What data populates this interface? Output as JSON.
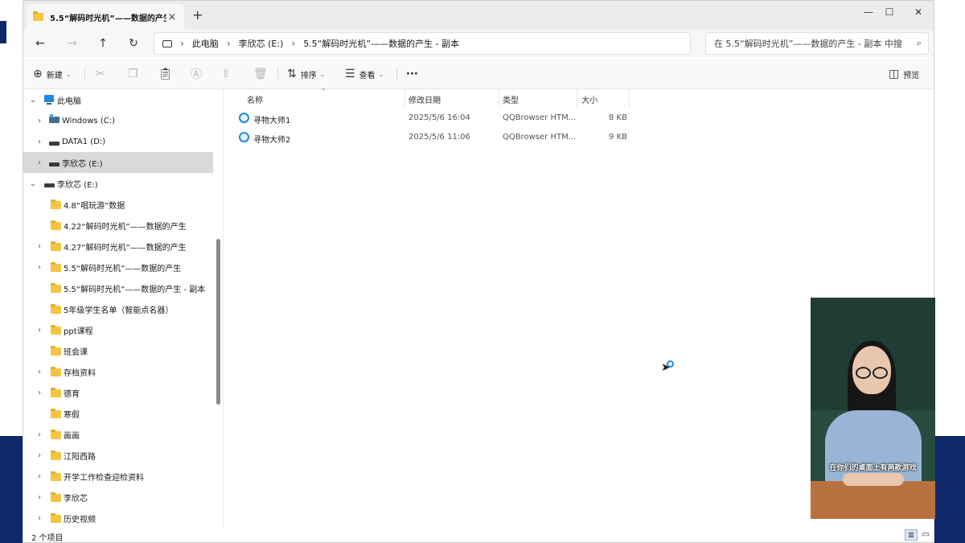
{
  "window": {
    "tab_title": "5.5“解码时光机”——数据的产生",
    "tab_close": "×",
    "new_tab": "+",
    "minimize": "—",
    "maximize": "☐",
    "close": "✕"
  },
  "nav": {
    "back": "←",
    "forward": "→",
    "up": "↑",
    "refresh": "↻",
    "breadcrumb": [
      "此电脑",
      "李欣芯 (E:)",
      "5.5“解码时光机”——数据的产生 - 副本"
    ],
    "search_placeholder": "在 5.5“解码时光机”——数据的产生 - 副本 中搜"
  },
  "toolbar": {
    "new_label": "新建",
    "sort_label": "排序",
    "view_label": "查看",
    "more_label": "···",
    "preview_label": "预览"
  },
  "sidebar": {
    "items": [
      {
        "label": "此电脑",
        "icon": "pc"
      },
      {
        "label": "Windows (C:)",
        "icon": "windows-drive"
      },
      {
        "label": "DATA1 (D:)",
        "icon": "drive"
      },
      {
        "label": "李欣芯 (E:)",
        "icon": "drive"
      },
      {
        "label": "李欣芯 (E:)",
        "icon": "drive"
      },
      {
        "label": "4.8“唱玩游”数据",
        "icon": "folder"
      },
      {
        "label": "4.22“解码时光机”——数据的产生",
        "icon": "folder"
      },
      {
        "label": "4.27“解码时光机”——数据的产生",
        "icon": "folder"
      },
      {
        "label": "5.5“解码时光机”——数据的产生",
        "icon": "folder"
      },
      {
        "label": "5.5“解码时光机”——数据的产生 - 副本",
        "icon": "folder"
      },
      {
        "label": "5年级学生名单（智能点名器）",
        "icon": "folder"
      },
      {
        "label": "ppt课程",
        "icon": "folder"
      },
      {
        "label": "班会课",
        "icon": "folder"
      },
      {
        "label": "存档资料",
        "icon": "folder"
      },
      {
        "label": "德育",
        "icon": "folder"
      },
      {
        "label": "寒假",
        "icon": "folder"
      },
      {
        "label": "画画",
        "icon": "folder"
      },
      {
        "label": "江阳西路",
        "icon": "folder"
      },
      {
        "label": "开学工作检查迎检资料",
        "icon": "folder"
      },
      {
        "label": "李欣芯",
        "icon": "folder"
      },
      {
        "label": "历史视频",
        "icon": "folder"
      }
    ]
  },
  "file_list": {
    "columns": [
      "名称",
      "修改日期",
      "类型",
      "大小"
    ],
    "rows": [
      {
        "name": "寻物大师1",
        "date": "2025/5/6 16:04",
        "type": "QQBrowser HTM...",
        "size": "8 KB"
      },
      {
        "name": "寻物大师2",
        "date": "2025/5/6 11:06",
        "type": "QQBrowser HTM...",
        "size": "9 KB"
      }
    ]
  },
  "status": {
    "item_count": "2 个项目"
  },
  "video_overlay": {
    "caption": "在你们的桌面上有两款游戏"
  },
  "colors": {
    "accent": "#1e88e5",
    "slide_band": "#0f2a6b",
    "folder": "#f4c542",
    "selection": "#d9d9d9"
  }
}
